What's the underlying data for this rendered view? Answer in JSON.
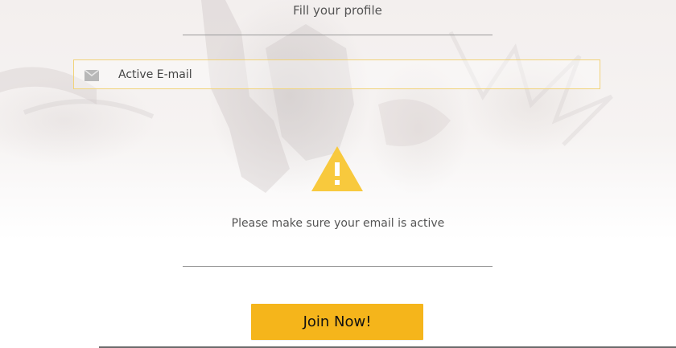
{
  "header": {
    "title": "Fill your profile"
  },
  "form": {
    "email_placeholder": "Active E-mail",
    "email_value": "",
    "mail_icon": "mail-icon"
  },
  "notice": {
    "icon": "warning-icon",
    "text": "Please make sure your email is active"
  },
  "actions": {
    "join_label": "Join Now!"
  },
  "colors": {
    "accent": "#f5b51b",
    "warning": "#f8c93d",
    "field_border": "#f1d37a",
    "text": "#555555"
  }
}
